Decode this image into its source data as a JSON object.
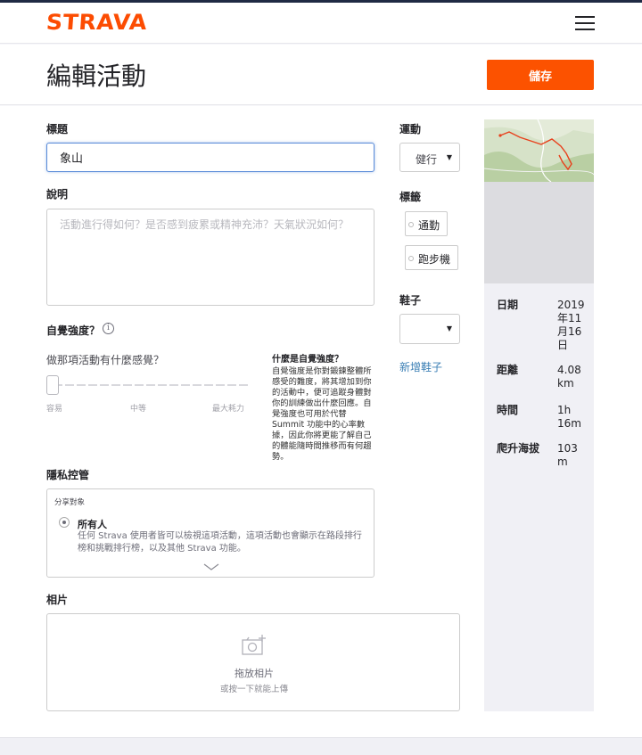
{
  "brand": {
    "logo_text": "STRAVA",
    "accent": "#fc4c02"
  },
  "header": {
    "title": "編輯活動",
    "save_label": "儲存"
  },
  "form": {
    "title_label": "標題",
    "title_value": "象山",
    "desc_label": "說明",
    "desc_placeholder": "活動進行得如何？是否感到疲累或精神充沛？天氣狀況如何？",
    "exertion_label": "自覺強度？",
    "exertion_question": "做那項活動有什麼感覺？",
    "exertion_level": 0,
    "slider_ticks": [
      "容易",
      "中等",
      "最大耗力"
    ],
    "exertion_help_title": "什麼是自覺強度？",
    "exertion_help_body": "自覺強度是你對鍛鍊整體所感受的難度，將其增加到你的活動中，便可追蹤身體對你的訓練做出什麼回應。自覺強度也可用於代替Summit 功能中的心率數據，因此你將更能了解自己的體能隨時間推移而有何趨勢。",
    "privacy_label": "隱私控管",
    "privacy_caption": "分享對象",
    "privacy_option": "所有人",
    "privacy_desc": "任何 Strava 使用者皆可以檢視這項活動，這項活動也會顯示在路段排行榜和挑戰排行榜，以及其他 Strava 功能。",
    "photos_label": "相片",
    "photos_drop": "拖放相片",
    "photos_sub": "或按一下就能上傳"
  },
  "side": {
    "sport_label": "運動",
    "sport_value": "健行",
    "tags_label": "標籤",
    "tags": [
      "通勤",
      "跑步機"
    ],
    "shoes_label": "鞋子",
    "shoes_value": "",
    "add_shoes": "新增鞋子"
  },
  "stats": {
    "date_label": "日期",
    "date_value": "2019年11月16日",
    "distance_label": "距離",
    "distance_value": "4.08 km",
    "time_label": "時間",
    "time_value": "1h 16m",
    "elev_label": "爬升海拔",
    "elev_value": "103 m"
  }
}
